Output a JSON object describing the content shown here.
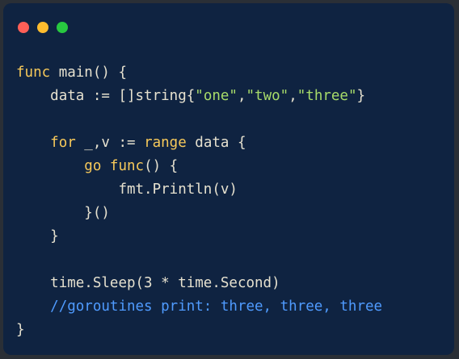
{
  "window": {
    "controls": {
      "close_color": "#ff5f57",
      "minimize_color": "#febc2e",
      "maximize_color": "#28c840"
    }
  },
  "theme": {
    "background": "#0f2341",
    "keyword": "#f7c95a",
    "string": "#a8dc6a",
    "comment": "#4f9bff",
    "plain": "#e6e1cf"
  },
  "code": {
    "line1": {
      "kw": "func",
      "rest": " main() {"
    },
    "line2": {
      "indent": "    ",
      "pre": "data := []string{",
      "s1": "\"one\"",
      "c1": ",",
      "s2": "\"two\"",
      "c2": ",",
      "s3": "\"three\"",
      "post": "}"
    },
    "line4": {
      "indent": "    ",
      "kw1": "for",
      "mid": " _,v := ",
      "kw2": "range",
      "rest": " data {"
    },
    "line5": {
      "indent": "        ",
      "kw1": "go",
      "sp": " ",
      "kw2": "func",
      "rest": "() {"
    },
    "line6": {
      "indent": "            ",
      "text": "fmt.Println(v)"
    },
    "line7": {
      "indent": "        ",
      "text": "}()"
    },
    "line8": {
      "indent": "    ",
      "text": "}"
    },
    "line10": {
      "indent": "    ",
      "text": "time.Sleep(3 * time.Second)"
    },
    "line11": {
      "indent": "    ",
      "comment": "//goroutines print: three, three, three"
    },
    "line12": {
      "text": "}"
    }
  }
}
